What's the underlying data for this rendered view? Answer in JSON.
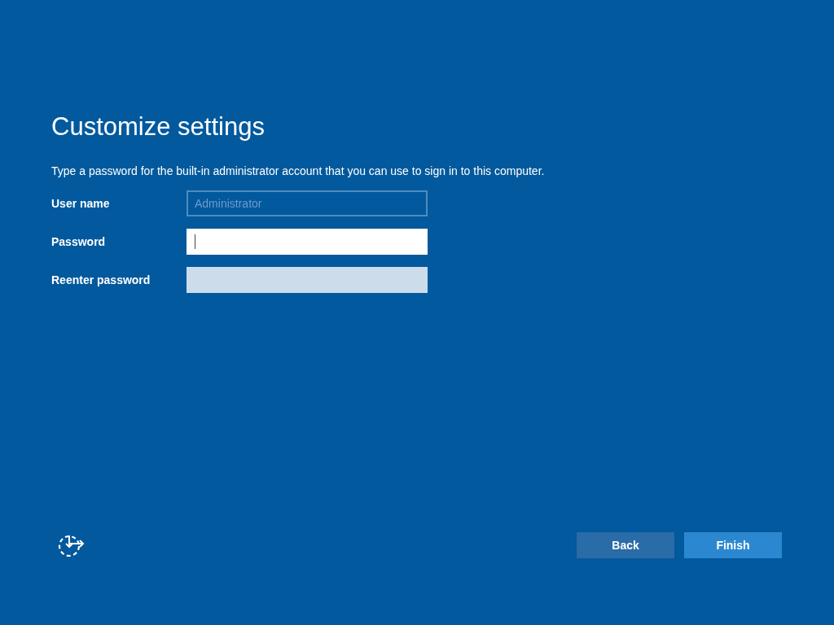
{
  "title": "Customize settings",
  "instruction": "Type a password for the built-in administrator account that you can use to sign in to this computer.",
  "fields": [
    {
      "label": "User name",
      "value": "Administrator",
      "disabled": true,
      "focused": false
    },
    {
      "label": "Password",
      "disabled": false,
      "focused": true
    },
    {
      "label": "Reenter password",
      "disabled": false,
      "focused": false
    }
  ],
  "buttons": [
    {
      "label": "Back",
      "kind": "secondary"
    },
    {
      "label": "Finish",
      "kind": "primary"
    }
  ]
}
